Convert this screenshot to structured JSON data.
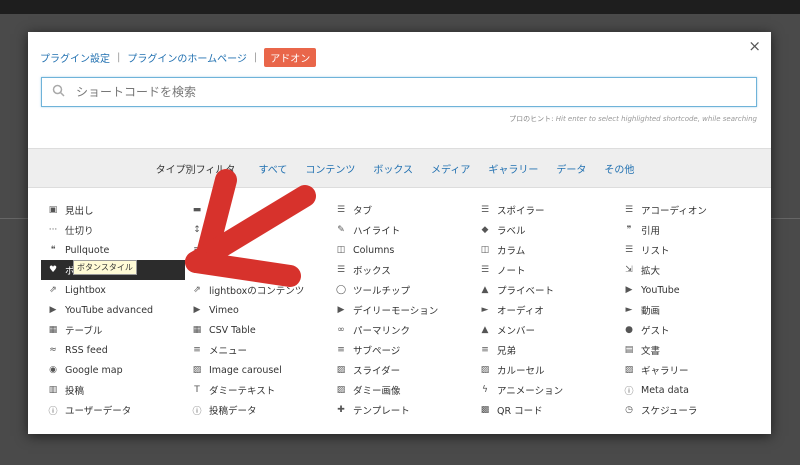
{
  "header": {
    "link_settings": "プラグイン設定",
    "link_homepage": "プラグインのホームページ",
    "addon_badge": "アドオン",
    "separator": "|",
    "close": "×"
  },
  "search": {
    "placeholder": "ショートコードを検索",
    "hint_label": "プロのヒント:",
    "hint_text": "Hit enter to select highlighted shortcode, while searching"
  },
  "filter": {
    "label": "タイプ別フィルタ",
    "options": [
      "すべて",
      "コンテンツ",
      "ボックス",
      "メディア",
      "ギャラリー",
      "データ",
      "その他"
    ]
  },
  "colors": {
    "accent": "#2271b1",
    "addon": "#e9664a",
    "arrow": "#d7322c",
    "active_item_bg": "#2c2c2c"
  },
  "shortcodes": [
    {
      "label": "見出し",
      "icon": "header-icon"
    },
    {
      "label": "",
      "icon": "divider-icon"
    },
    {
      "label": "タブ",
      "icon": "list-icon"
    },
    {
      "label": "スポイラー",
      "icon": "list-icon"
    },
    {
      "label": "アコーディオン",
      "icon": "list-icon"
    },
    {
      "label": "仕切り",
      "icon": "ellipsis-icon"
    },
    {
      "label": "",
      "icon": "arrows-v-icon"
    },
    {
      "label": "ハイライト",
      "icon": "pencil-icon"
    },
    {
      "label": "ラベル",
      "icon": "tag-icon"
    },
    {
      "label": "引用",
      "icon": "quote-icon"
    },
    {
      "label": "Pullquote",
      "icon": "quote-left-icon"
    },
    {
      "label": "",
      "icon": "align-icon"
    },
    {
      "label": "Columns",
      "icon": "columns-icon"
    },
    {
      "label": "カラム",
      "icon": "columns-icon"
    },
    {
      "label": "リスト",
      "icon": "list-icon"
    },
    {
      "label": "ボタン",
      "icon": "heart-icon",
      "active": true
    },
    {
      "label": "",
      "icon": "check-icon"
    },
    {
      "label": "ボックス",
      "icon": "list-icon"
    },
    {
      "label": "ノート",
      "icon": "list-icon"
    },
    {
      "label": "拡大",
      "icon": "expand-icon"
    },
    {
      "label": "Lightbox",
      "icon": "external-link-icon"
    },
    {
      "label": "lightboxのコンテンツ",
      "icon": "external-link-icon"
    },
    {
      "label": "ツールチップ",
      "icon": "comment-icon"
    },
    {
      "label": "プライベート",
      "icon": "lock-icon"
    },
    {
      "label": "YouTube",
      "icon": "youtube-icon"
    },
    {
      "label": "YouTube advanced",
      "icon": "youtube-icon"
    },
    {
      "label": "Vimeo",
      "icon": "youtube-icon"
    },
    {
      "label": "デイリーモーション",
      "icon": "youtube-icon"
    },
    {
      "label": "オーディオ",
      "icon": "play-icon"
    },
    {
      "label": "動画",
      "icon": "play-icon"
    },
    {
      "label": "テーブル",
      "icon": "table-icon"
    },
    {
      "label": "CSV Table",
      "icon": "table-icon"
    },
    {
      "label": "パーマリンク",
      "icon": "link-icon"
    },
    {
      "label": "メンバー",
      "icon": "lock-icon"
    },
    {
      "label": "ゲスト",
      "icon": "user-icon"
    },
    {
      "label": "RSS feed",
      "icon": "rss-icon"
    },
    {
      "label": "メニュー",
      "icon": "bars-icon"
    },
    {
      "label": "サブページ",
      "icon": "bars-icon"
    },
    {
      "label": "兄弟",
      "icon": "bars-icon"
    },
    {
      "label": "文書",
      "icon": "file-icon"
    },
    {
      "label": "Google map",
      "icon": "globe-icon"
    },
    {
      "label": "Image carousel",
      "icon": "image-icon"
    },
    {
      "label": "スライダー",
      "icon": "image-icon"
    },
    {
      "label": "カルーセル",
      "icon": "image-icon"
    },
    {
      "label": "ギャラリー",
      "icon": "image-icon"
    },
    {
      "label": "投稿",
      "icon": "th-list-icon"
    },
    {
      "label": "ダミーテキスト",
      "icon": "text-height-icon"
    },
    {
      "label": "ダミー画像",
      "icon": "image-icon"
    },
    {
      "label": "アニメーション",
      "icon": "bolt-icon"
    },
    {
      "label": "Meta data",
      "icon": "info-icon"
    },
    {
      "label": "ユーザーデータ",
      "icon": "info-icon"
    },
    {
      "label": "投稿データ",
      "icon": "info-icon"
    },
    {
      "label": "テンプレート",
      "icon": "puzzle-icon"
    },
    {
      "label": "QR コード",
      "icon": "qrcode-icon"
    },
    {
      "label": "スケジューラ",
      "icon": "clock-icon"
    }
  ],
  "tooltip": "ボタンスタイル"
}
